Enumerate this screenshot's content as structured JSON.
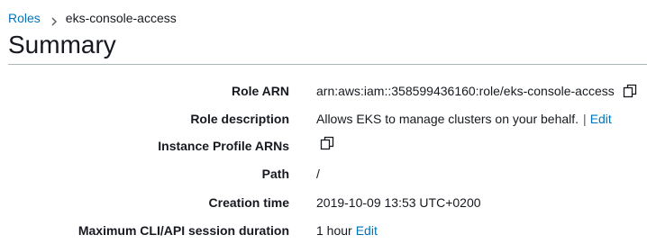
{
  "breadcrumb": {
    "parent": "Roles",
    "current": "eks-console-access"
  },
  "page": {
    "title": "Summary"
  },
  "summary": {
    "role_arn": {
      "label": "Role ARN",
      "value": "arn:aws:iam::358599436160:role/eks-console-access"
    },
    "role_description": {
      "label": "Role description",
      "value": "Allows EKS to manage clusters on your behalf.",
      "separator": "|",
      "edit_label": "Edit"
    },
    "instance_profile_arns": {
      "label": "Instance Profile ARNs"
    },
    "path": {
      "label": "Path",
      "value": "/"
    },
    "creation_time": {
      "label": "Creation time",
      "value": "2019-10-09 13:53 UTC+0200"
    },
    "max_session_duration": {
      "label": "Maximum CLI/API session duration",
      "value": "1 hour",
      "edit_label": "Edit"
    }
  },
  "colors": {
    "link": "#0073bb",
    "text": "#16191f",
    "rule": "#aab7b8"
  },
  "icons": {
    "copy": "copy-icon",
    "breadcrumb_separator": "chevron-right-icon"
  }
}
